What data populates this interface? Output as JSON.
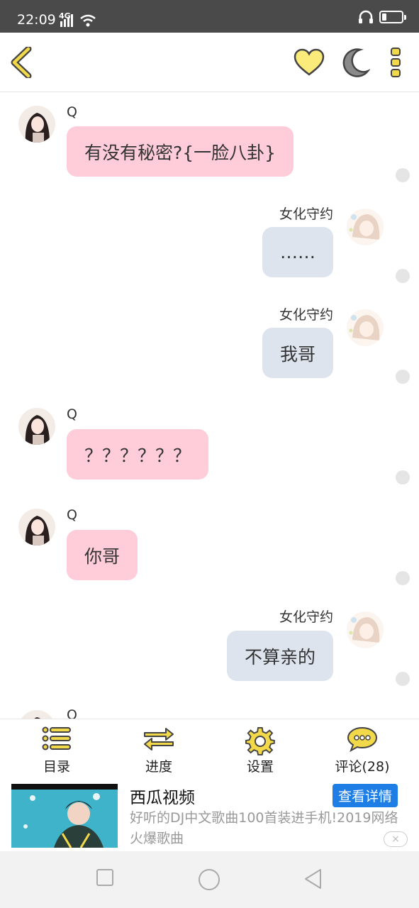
{
  "status_bar": {
    "time": "22:09",
    "signal_label": "4G",
    "icons": [
      "signal-icon",
      "wifi-icon",
      "headphones-icon",
      "battery-icon"
    ]
  },
  "toolbar": {
    "icons": [
      "back-icon",
      "heart-icon",
      "moon-icon",
      "more-icon"
    ],
    "accent_color": "#f2d94a"
  },
  "messages": [
    {
      "side": "left",
      "sender": "Q",
      "text": "有没有秘密?{一脸八卦}"
    },
    {
      "side": "right",
      "sender": "女化守约",
      "text": "……"
    },
    {
      "side": "right",
      "sender": "女化守约",
      "text": "我哥"
    },
    {
      "side": "left",
      "sender": "Q",
      "text": "？？？？？？"
    },
    {
      "side": "left",
      "sender": "Q",
      "text": "你哥"
    },
    {
      "side": "right",
      "sender": "女化守约",
      "text": "不算亲的"
    },
    {
      "side": "left",
      "sender": "Q",
      "text": ""
    }
  ],
  "bottom_nav": {
    "items": [
      {
        "label": "目录",
        "icon": "list-icon"
      },
      {
        "label": "进度",
        "icon": "swap-arrows-icon"
      },
      {
        "label": "设置",
        "icon": "gear-icon"
      },
      {
        "label": "评论(28)",
        "icon": "comment-icon"
      }
    ]
  },
  "ad": {
    "title": "西瓜视频",
    "description": "好听的DJ中文歌曲100首装进手机!2019网络火爆歌曲",
    "cta": "查看详情",
    "close": "×"
  },
  "colors": {
    "left_bubble": "#ffccd9",
    "right_bubble": "#dde4ee",
    "cta": "#1e7ee6"
  }
}
